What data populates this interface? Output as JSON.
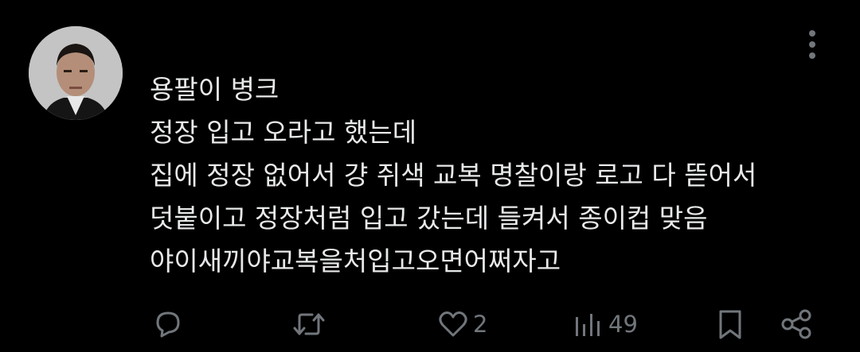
{
  "post": {
    "lines": [
      "용팔이 병크",
      "정장 입고 오라고 했는데",
      "집에 정장 없어서 걍 쥐색 교복 명찰이랑 로고 다 뜯어서",
      "덧붙이고 정장처럼 입고 갔는데 들켜서 종이컵 맞음",
      "야이새끼야교복을처입고오면어쩌자고"
    ]
  },
  "actions": {
    "reply": {
      "icon": "reply-icon",
      "count": ""
    },
    "repost": {
      "icon": "repost-icon",
      "count": ""
    },
    "like": {
      "icon": "heart-icon",
      "count": "2"
    },
    "views": {
      "icon": "views-icon",
      "count": "49"
    },
    "bookmark": {
      "icon": "bookmark-icon"
    },
    "share": {
      "icon": "share-icon"
    }
  },
  "colors": {
    "background": "#000000",
    "text": "#e7e9ea",
    "muted": "#71767b"
  }
}
